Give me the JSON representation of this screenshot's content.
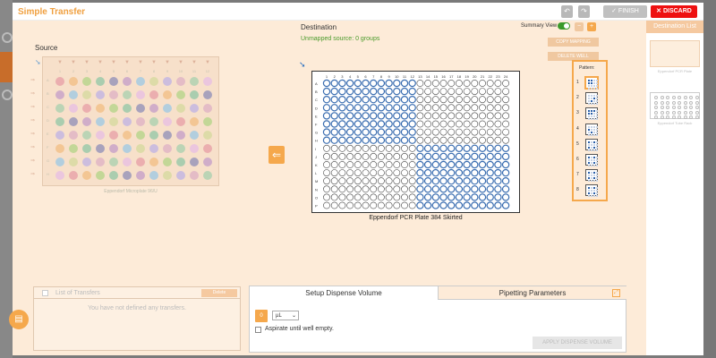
{
  "app": {
    "title": "Simple Transfer"
  },
  "toolbar": {
    "undo_icon": "undo-icon",
    "redo_icon": "redo-icon",
    "finish": "✓ FINISH",
    "discard": "✕ DISCARD"
  },
  "source": {
    "label": "Source",
    "plate_name": "Eppendorf Microplate 96/U",
    "cols": [
      "1",
      "2",
      "3",
      "4",
      "5",
      "6",
      "7",
      "8",
      "9",
      "10",
      "11",
      "12"
    ],
    "rows": [
      "A",
      "B",
      "C",
      "D",
      "E",
      "F",
      "G",
      "H"
    ]
  },
  "destination": {
    "label": "Destination",
    "unmapped": "Unmapped source: 0 groups",
    "summary_view": "Summary View",
    "copy_mapping": "COPY MAPPING",
    "delete_wells": "DELETE WELL",
    "plate_name": "Eppendorf PCR Plate 384 Skirted",
    "cols": [
      "1",
      "2",
      "3",
      "4",
      "5",
      "6",
      "7",
      "8",
      "9",
      "10",
      "11",
      "12",
      "13",
      "14",
      "15",
      "16",
      "17",
      "18",
      "19",
      "20",
      "21",
      "22",
      "23",
      "24"
    ],
    "rows": [
      "A",
      "B",
      "C",
      "D",
      "E",
      "F",
      "G",
      "H",
      "I",
      "J",
      "K",
      "L",
      "M",
      "N",
      "O",
      "P"
    ]
  },
  "pattern": {
    "title": "Pattern:",
    "items": [
      "1",
      "2",
      "3",
      "4",
      "5",
      "6",
      "7",
      "8"
    ]
  },
  "destination_list": {
    "header": "Destination List",
    "plates": [
      "Eppendorf PCR Plate",
      "Eppendorf Tube Rack"
    ]
  },
  "transfers": {
    "title": "List of Transfers",
    "delete": "Delete",
    "empty": "You have not defined any transfers."
  },
  "tabs": {
    "setup": "Setup Dispense Volume",
    "pipetting": "Pipetting Parameters"
  },
  "dispense": {
    "volume": "0",
    "unit": "µL",
    "aspirate_label": "Aspirate until well empty.",
    "apply": "APPLY DISPENSE VOLUME"
  },
  "colors": {
    "accent": "#f5a84c",
    "discard": "#e11111",
    "toggle": "#3a9a2a",
    "well_blue": "#3a6db0"
  }
}
